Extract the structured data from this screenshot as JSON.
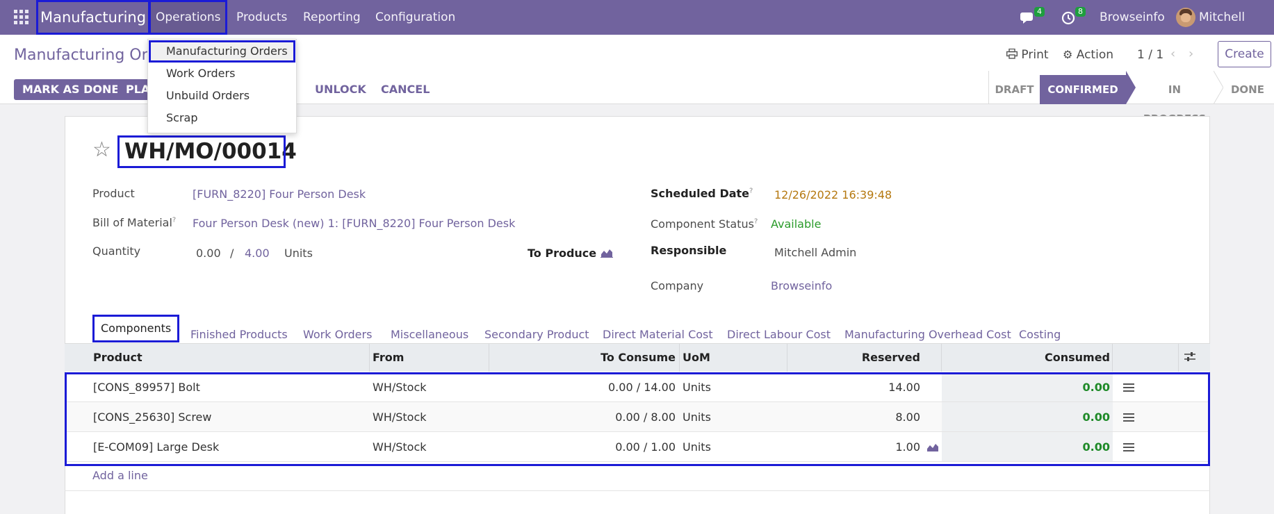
{
  "colors": {
    "brand": "#71639e",
    "highlight": "#1b1bd6",
    "success": "#1e8a28",
    "warning": "#b5780f"
  },
  "navbar": {
    "apps_icon": "apps-grid-icon",
    "app_name": "Manufacturing",
    "menus": [
      "Operations",
      "Products",
      "Reporting",
      "Configuration"
    ],
    "chat_count": "4",
    "activity_count": "8",
    "company": "Browseinfo",
    "user": "Mitchell Admin"
  },
  "operations_menu": {
    "items": [
      "Manufacturing Orders",
      "Work Orders",
      "Unbuild Orders",
      "Scrap"
    ]
  },
  "control_panel": {
    "breadcrumb": "Manufacturing Orders",
    "print": "Print",
    "action": "Action",
    "pager": "1 / 1",
    "create": "Create",
    "buttons": {
      "mark_done": "MARK AS DONE",
      "plan": "PLAN",
      "unlock": "UNLOCK",
      "cancel": "CANCEL"
    },
    "statuses": [
      "DRAFT",
      "CONFIRMED",
      "IN PROGRESS",
      "DONE"
    ],
    "current_status": "CONFIRMED"
  },
  "form": {
    "name": "WH/MO/00014",
    "product_label": "Product",
    "product": "[FURN_8220] Four Person Desk",
    "bom_label": "Bill of Material",
    "bom": "Four Person Desk (new) 1: [FURN_8220] Four Person Desk",
    "quantity_label": "Quantity",
    "qty_produced": "0.00",
    "qty_sep": "/",
    "qty_total": "4.00",
    "qty_uom": "Units",
    "to_produce": "To Produce",
    "scheduled_label": "Scheduled Date",
    "scheduled": "12/26/2022 16:39:48",
    "component_status_label": "Component Status",
    "component_status": "Available",
    "responsible_label": "Responsible",
    "responsible": "Mitchell Admin",
    "company_label": "Company",
    "company": "Browseinfo",
    "help_mark": "?"
  },
  "tabs": [
    "Components",
    "Finished Products",
    "Work Orders",
    "Miscellaneous",
    "Secondary Product",
    "Direct Material Cost",
    "Direct Labour Cost",
    "Manufacturing Overhead Cost",
    "Costing"
  ],
  "table": {
    "headers": {
      "product": "Product",
      "from": "From",
      "to_consume": "To Consume",
      "uom": "UoM",
      "reserved": "Reserved",
      "consumed": "Consumed"
    },
    "rows": [
      {
        "product": "[CONS_89957] Bolt",
        "from": "WH/Stock",
        "to_consume": "0.00 /  14.00",
        "uom": "Units",
        "reserved": "14.00",
        "consumed": "0.00"
      },
      {
        "product": "[CONS_25630] Screw",
        "from": "WH/Stock",
        "to_consume": "0.00 /  8.00",
        "uom": "Units",
        "reserved": "8.00",
        "consumed": "0.00"
      },
      {
        "product": "[E-COM09] Large Desk",
        "from": "WH/Stock",
        "to_consume": "0.00 /  1.00",
        "uom": "Units",
        "reserved": "1.00",
        "consumed": "0.00"
      }
    ],
    "add_line": "Add a line"
  }
}
